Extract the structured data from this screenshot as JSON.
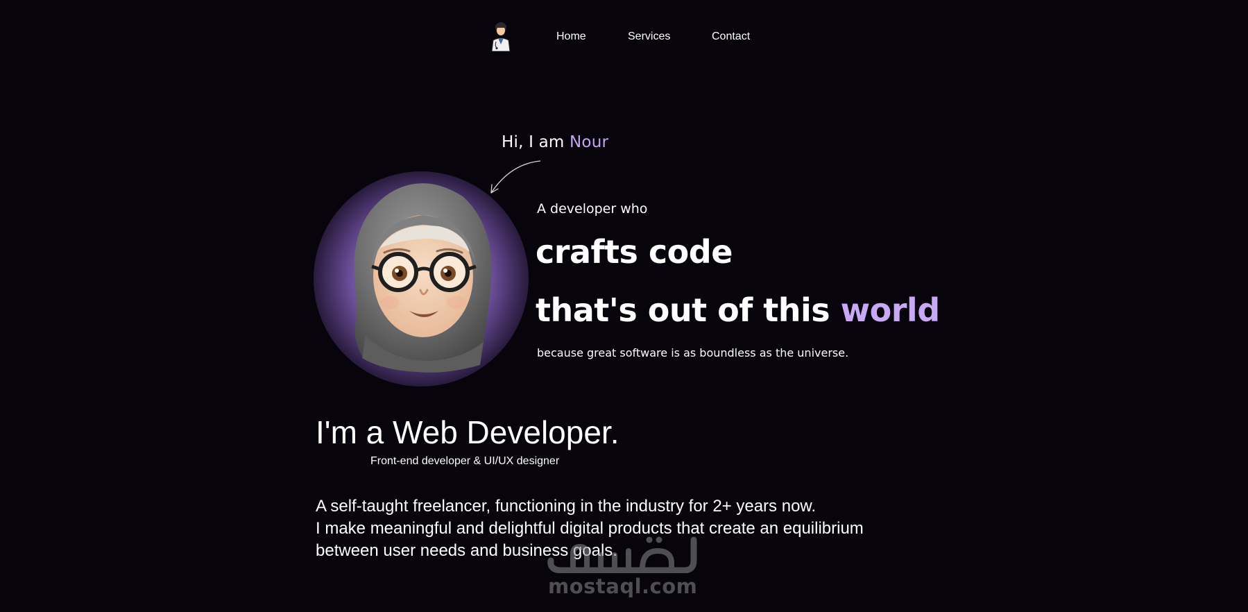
{
  "nav": {
    "logo_icon": "developer-avatar-icon",
    "links": [
      {
        "label": "Home"
      },
      {
        "label": "Services"
      },
      {
        "label": "Contact"
      }
    ]
  },
  "hero": {
    "greeting_prefix": "Hi, I am ",
    "greeting_name": "Nour",
    "intro": "A developer who",
    "headline_line1": "crafts code",
    "headline_line2_prefix": "that's out of this ",
    "headline_line2_accent": "world",
    "tagline": "because great software is as boundless as the universe.",
    "avatar_icon": "hijab-memoji-avatar",
    "arrow_icon": "curved-arrow-icon"
  },
  "about": {
    "title": "I'm a Web Developer.",
    "subtitle": "Front-end developer & UI/UX designer",
    "bio_lines": [
      "A self-taught freelancer, functioning in the industry for 2+ years now.",
      "I make meaningful and delightful digital products that create an equilibrium",
      "between user needs and business goals."
    ]
  },
  "watermark": {
    "arabic": "مستقل",
    "domain": "mostaql.com"
  },
  "colors": {
    "background": "#07040b",
    "accent": "#c4a6f5",
    "text": "#ffffff"
  }
}
